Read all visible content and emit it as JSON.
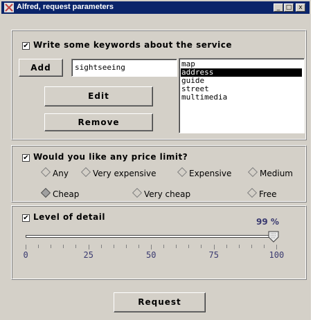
{
  "window": {
    "title": "Alfred, request parameters",
    "minimize": "_",
    "maximize": "□",
    "close": "x"
  },
  "keywords": {
    "checked": true,
    "label": "Write some keywords about the service",
    "add_label": "Add",
    "input_value": "sightseeing",
    "edit_label": "Edit",
    "remove_label": "Remove",
    "items": [
      "map",
      "address",
      "guide",
      "street",
      "multimedia"
    ],
    "selected": "address"
  },
  "price": {
    "checked": true,
    "label": "Would you like any price limit?",
    "options": [
      "Any",
      "Very expensive",
      "Expensive",
      "Medium",
      "Cheap",
      "Very cheap",
      "Free"
    ],
    "selected": "Cheap"
  },
  "detail": {
    "checked": true,
    "label": "Level of detail",
    "value_display": "99 %",
    "value": 99,
    "scale_labels": [
      "0",
      "25",
      "50",
      "75",
      "100"
    ]
  },
  "request_label": "Request"
}
